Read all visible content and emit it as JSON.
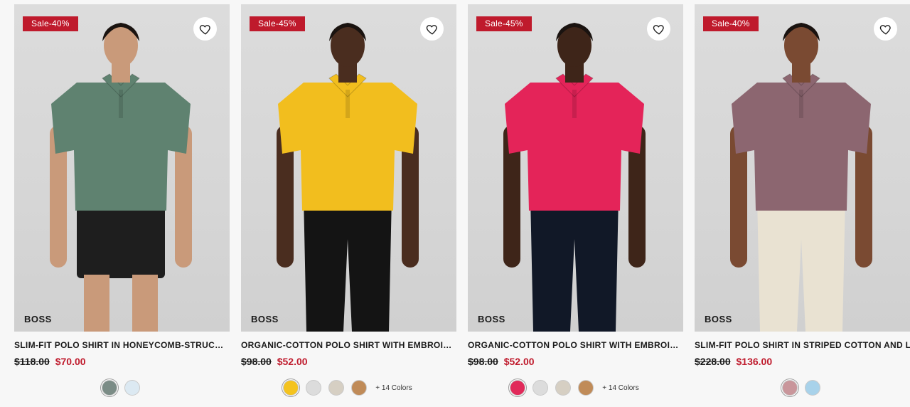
{
  "products": [
    {
      "badge": "Sale-40%",
      "brand": "BOSS",
      "title": "SLIM-FIT POLO SHIRT IN HONEYCOMB-STRUCTURED ...",
      "old_price": "$118.00",
      "new_price": "$70.00",
      "shirt_color": "#5f8270",
      "pants_color": "#1e1e1e",
      "skin_color": "#c99a7a",
      "swatches": [
        "#7b8c86",
        "#dce9f2"
      ],
      "more": ""
    },
    {
      "badge": "Sale-45%",
      "brand": "BOSS",
      "title": "ORGANIC-COTTON POLO SHIRT WITH EMBROIDERED...",
      "old_price": "$98.00",
      "new_price": "$52.00",
      "shirt_color": "#f2be1e",
      "pants_color": "#141414",
      "skin_color": "#4a2d1f",
      "swatches": [
        "#f4c31f",
        "#dcdcdc",
        "#d6cfc3",
        "#c08b58"
      ],
      "more": "+ 14 Colors"
    },
    {
      "badge": "Sale-45%",
      "brand": "BOSS",
      "title": "ORGANIC-COTTON POLO SHIRT WITH EMBROIDERED...",
      "old_price": "$98.00",
      "new_price": "$52.00",
      "shirt_color": "#e42459",
      "pants_color": "#111827",
      "skin_color": "#3e2519",
      "swatches": [
        "#e12a5a",
        "#dcdcdc",
        "#d6cfc3",
        "#c08b58"
      ],
      "more": "+ 14 Colors"
    },
    {
      "badge": "Sale-40%",
      "brand": "BOSS",
      "title": "SLIM-FIT POLO SHIRT IN STRIPED COTTON AND LINEN",
      "old_price": "$228.00",
      "new_price": "$136.00",
      "shirt_color": "#8c6670",
      "pants_color": "#e9e2d2",
      "skin_color": "#7a4a32",
      "swatches": [
        "#c9969b",
        "#a8d2ea"
      ],
      "more": ""
    }
  ],
  "colors": {
    "sale_red": "#bf1a2c",
    "page_bg": "#f7f7f7",
    "media_bg": "#d8d8d8"
  },
  "icons": {
    "wishlist": "heart-icon"
  }
}
